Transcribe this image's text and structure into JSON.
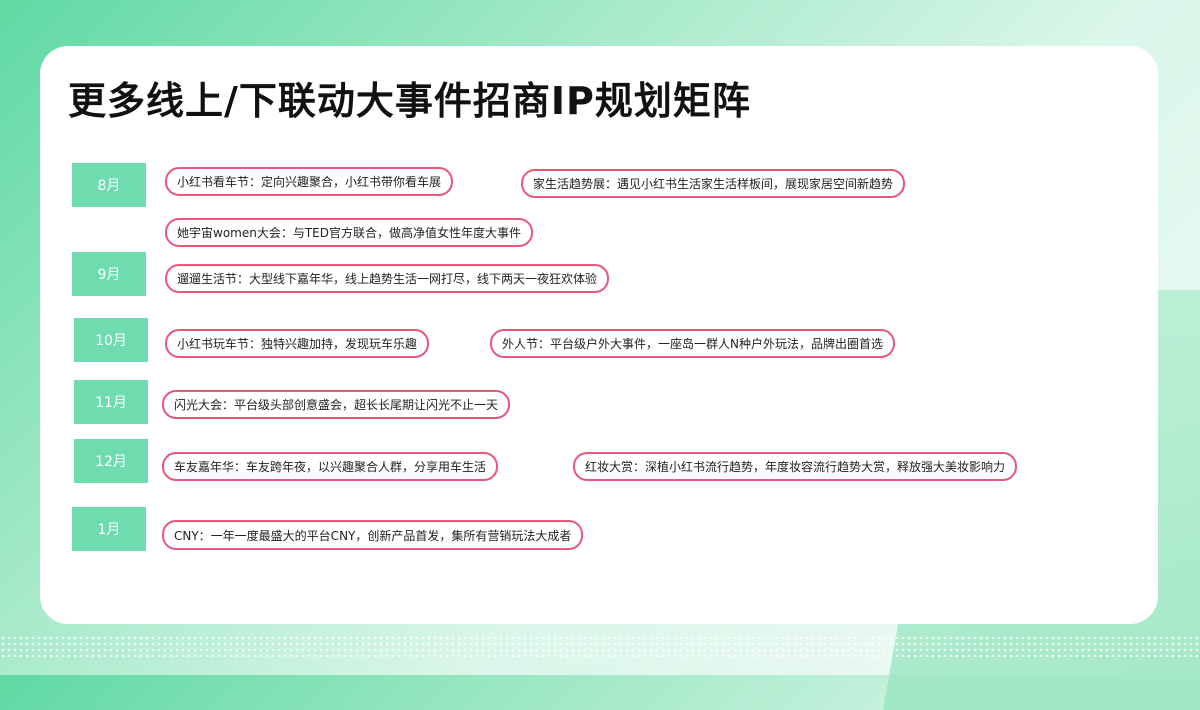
{
  "title": "更多线上/下联动大事件招商IP规划矩阵",
  "months": [
    {
      "label": "8月"
    },
    {
      "label": "9月"
    },
    {
      "label": "10月"
    },
    {
      "label": "11月"
    },
    {
      "label": "12月"
    },
    {
      "label": "1月"
    }
  ],
  "events": [
    {
      "text": "小红书看车节：定向兴趣聚合，小红书带你看车展"
    },
    {
      "text": "家生活趋势展：遇见小红书生活家生活样板间，展现家居空间新趋势"
    },
    {
      "text": "她宇宙women大会：与TED官方联合，做高净值女性年度大事件"
    },
    {
      "text": "遛遛生活节：大型线下嘉年华，线上趋势生活一网打尽，线下两天一夜狂欢体验"
    },
    {
      "text": "小红书玩车节：独特兴趣加持，发现玩车乐趣"
    },
    {
      "text": "外人节：平台级户外大事件，一座岛一群人N种户外玩法，品牌出圈首选"
    },
    {
      "text": "闪光大会：平台级头部创意盛会，超长长尾期让闪光不止一天"
    },
    {
      "text": "车友嘉年华：车友跨年夜，以兴趣聚合人群，分享用车生活"
    },
    {
      "text": "红妆大赏：深植小红书流行趋势，年度妆容流行趋势大赏，释放强大美妆影响力"
    },
    {
      "text": "CNY：一年一度最盛大的平台CNY，创新产品首发，集所有营销玩法大成者"
    }
  ]
}
